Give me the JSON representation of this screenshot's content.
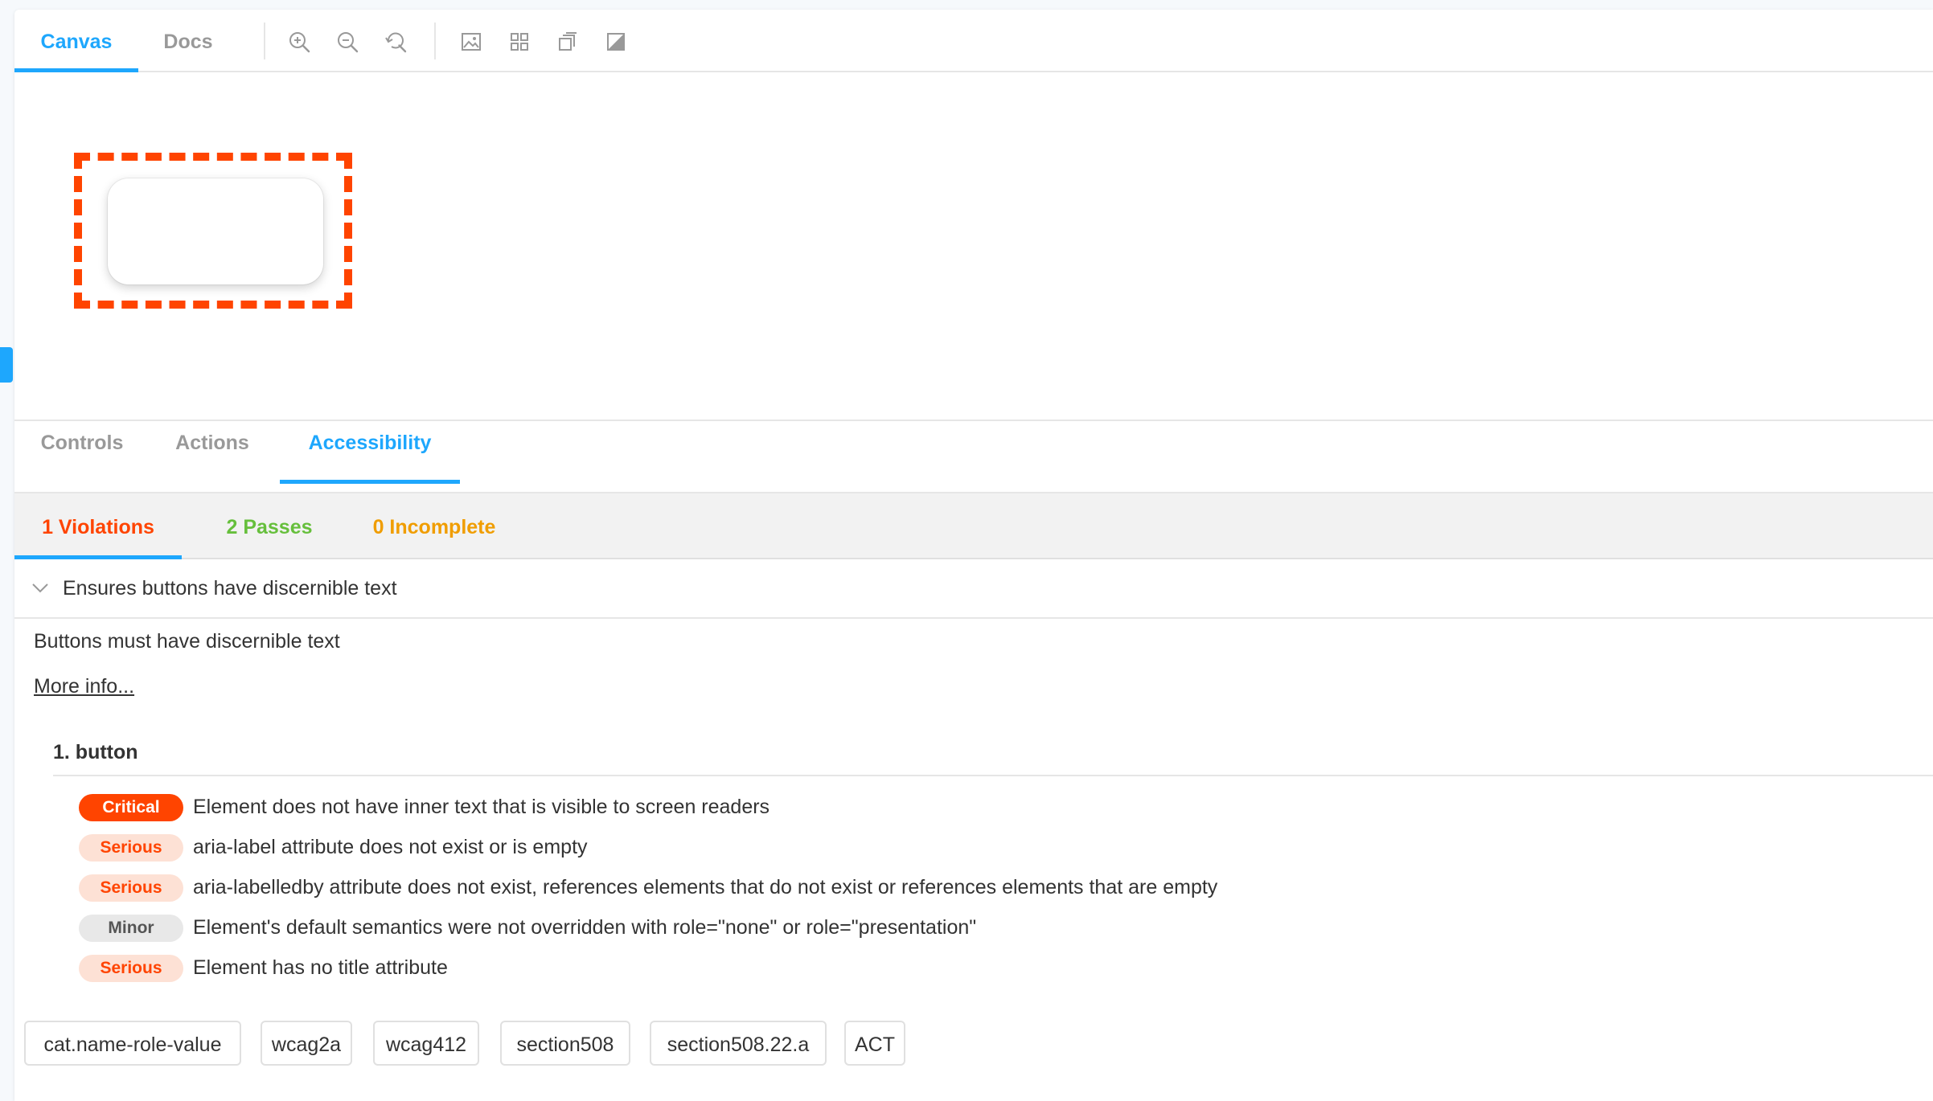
{
  "toolbar": {
    "tabs": [
      {
        "label": "Canvas",
        "active": true
      },
      {
        "label": "Docs",
        "active": false
      }
    ],
    "icons": [
      "zoom-in-icon",
      "zoom-out-icon",
      "reset-zoom-icon",
      "background-icon",
      "grid-icon",
      "viewport-icon",
      "contrast-icon"
    ]
  },
  "addons": {
    "tabs": [
      {
        "label": "Controls"
      },
      {
        "label": "Actions"
      },
      {
        "label": "Accessibility",
        "active": true
      }
    ]
  },
  "accessibility": {
    "subtabs": [
      {
        "label": "1 Violations",
        "color": "#ff4400",
        "active": true
      },
      {
        "label": "2 Passes",
        "color": "#66bf3c"
      },
      {
        "label": "0 Incomplete",
        "color": "#f09d00"
      }
    ],
    "rule": {
      "title": "Ensures buttons have discernible text",
      "description": "Buttons must have discernible text",
      "more_info": "More info...",
      "node_label": "1. button",
      "checks": [
        {
          "impact": "Critical",
          "text": "Element does not have inner text that is visible to screen readers"
        },
        {
          "impact": "Serious",
          "text": "aria-label attribute does not exist or is empty"
        },
        {
          "impact": "Serious",
          "text": "aria-labelledby attribute does not exist, references elements that do not exist or references elements that are empty"
        },
        {
          "impact": "Minor",
          "text": "Element's default semantics were not overridden with role=\"none\" or role=\"presentation\""
        },
        {
          "impact": "Serious",
          "text": "Element has no title attribute"
        }
      ],
      "tags": [
        "cat.name-role-value",
        "wcag2a",
        "wcag412",
        "section508",
        "section508.22.a",
        "ACT"
      ]
    }
  },
  "colors": {
    "accent": "#1ea7fd",
    "violation": "#ff4400",
    "critical_bg": "#ff4400",
    "serious_bg": "#fde1d5",
    "serious_fg": "#ff4400",
    "minor_bg": "#e8e8e8",
    "minor_fg": "#555555"
  }
}
